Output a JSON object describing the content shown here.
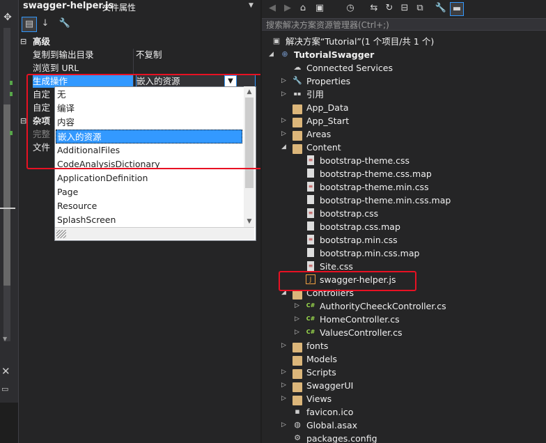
{
  "properties": {
    "file_name": "swagger-helper.js",
    "panel_label": "文件属性",
    "categories": [
      {
        "label": "高级"
      },
      {
        "label": "杂项"
      }
    ],
    "rows": {
      "copy_to_output": {
        "name": "复制到输出目录",
        "value": "不复制"
      },
      "browse_url": {
        "name": "浏览到 URL",
        "value": ""
      },
      "build_action": {
        "name": "生成操作",
        "value": "嵌入的资源"
      },
      "custom_tool": {
        "name": "自定义工具"
      },
      "custom_tool_ns": {
        "name": "自定义工具命名空间"
      },
      "full_path": {
        "name": "完整路径"
      },
      "file_name": {
        "name": "文件名"
      }
    }
  },
  "dropdown": {
    "options": [
      "无",
      "编译",
      "内容",
      "嵌入的资源",
      "AdditionalFiles",
      "CodeAnalysisDictionary",
      "ApplicationDefinition",
      "Page",
      "Resource",
      "SplashScreen"
    ],
    "selected_index": 3
  },
  "solution_explorer": {
    "search_placeholder": "搜索解决方案资源管理器(Ctrl+;)",
    "solution": "解决方案“Tutorial”(1 个项目/共 1 个)",
    "project": "TutorialSwagger",
    "items": [
      {
        "label": "Connected Services",
        "icon": "cloud-icon",
        "level": 2,
        "arrow": ""
      },
      {
        "label": "Properties",
        "icon": "wrench-icon",
        "level": 2,
        "arrow": "collapsed"
      },
      {
        "label": "引用",
        "icon": "references-icon",
        "level": 2,
        "arrow": "collapsed"
      },
      {
        "label": "App_Data",
        "icon": "folder-icon",
        "level": 2,
        "arrow": ""
      },
      {
        "label": "App_Start",
        "icon": "folder-icon",
        "level": 2,
        "arrow": "collapsed"
      },
      {
        "label": "Areas",
        "icon": "folder-icon",
        "level": 2,
        "arrow": "collapsed"
      },
      {
        "label": "Content",
        "icon": "folder-icon",
        "level": 2,
        "arrow": "expanded"
      },
      {
        "label": "bootstrap-theme.css",
        "icon": "css-file-icon",
        "level": 3,
        "arrow": ""
      },
      {
        "label": "bootstrap-theme.css.map",
        "icon": "file-icon",
        "level": 3,
        "arrow": ""
      },
      {
        "label": "bootstrap-theme.min.css",
        "icon": "css-file-icon",
        "level": 3,
        "arrow": ""
      },
      {
        "label": "bootstrap-theme.min.css.map",
        "icon": "file-icon",
        "level": 3,
        "arrow": ""
      },
      {
        "label": "bootstrap.css",
        "icon": "css-file-icon",
        "level": 3,
        "arrow": ""
      },
      {
        "label": "bootstrap.css.map",
        "icon": "file-icon",
        "level": 3,
        "arrow": ""
      },
      {
        "label": "bootstrap.min.css",
        "icon": "css-file-icon",
        "level": 3,
        "arrow": ""
      },
      {
        "label": "bootstrap.min.css.map",
        "icon": "file-icon",
        "level": 3,
        "arrow": ""
      },
      {
        "label": "Site.css",
        "icon": "css-file-icon",
        "level": 3,
        "arrow": ""
      },
      {
        "label": "swagger-helper.js",
        "icon": "js-file-icon",
        "level": 3,
        "arrow": ""
      },
      {
        "label": "Controllers",
        "icon": "folder-icon",
        "level": 2,
        "arrow": "expanded"
      },
      {
        "label": "AuthorityCheeckController.cs",
        "icon": "csharp-file-icon",
        "level": 3,
        "arrow": "collapsed"
      },
      {
        "label": "HomeController.cs",
        "icon": "csharp-file-icon",
        "level": 3,
        "arrow": "collapsed"
      },
      {
        "label": "ValuesController.cs",
        "icon": "csharp-file-icon",
        "level": 3,
        "arrow": "collapsed"
      },
      {
        "label": "fonts",
        "icon": "folder-icon",
        "level": 2,
        "arrow": "collapsed"
      },
      {
        "label": "Models",
        "icon": "folder-icon",
        "level": 2,
        "arrow": ""
      },
      {
        "label": "Scripts",
        "icon": "folder-icon",
        "level": 2,
        "arrow": "collapsed"
      },
      {
        "label": "SwaggerUI",
        "icon": "folder-icon",
        "level": 2,
        "arrow": "collapsed"
      },
      {
        "label": "Views",
        "icon": "folder-icon",
        "level": 2,
        "arrow": "collapsed"
      },
      {
        "label": "favicon.ico",
        "icon": "image-file-icon",
        "level": 2,
        "arrow": ""
      },
      {
        "label": "Global.asax",
        "icon": "globe-file-icon",
        "level": 2,
        "arrow": "collapsed"
      },
      {
        "label": "packages.config",
        "icon": "config-file-icon",
        "level": 2,
        "arrow": ""
      }
    ]
  },
  "colors": {
    "highlight": "#3399ff",
    "annotation": "#e81123",
    "background": "#252526"
  }
}
